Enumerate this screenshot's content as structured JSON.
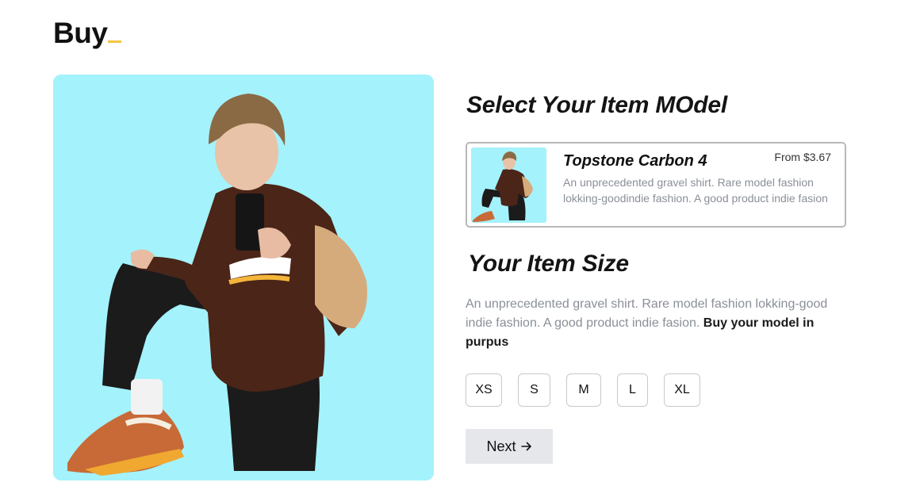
{
  "header": {
    "logo_text": "Buy",
    "logo_cursor_color": "#f4c542"
  },
  "hero": {
    "background_color": "#a4f2fb",
    "illustration": "person-in-brown-sweatshirt-kneeling"
  },
  "model_section": {
    "title": "Select Your Item MOdel",
    "card": {
      "name": "Topstone Carbon 4",
      "price": "From $3.67",
      "description": "An unprecedented gravel shirt. Rare model fashion lokking-goodindie fashion. A good product indie fasion"
    }
  },
  "size_section": {
    "title": "Your Item Size",
    "description": "An unprecedented gravel shirt. Rare model fashion lokking-good indie fashion. A good product indie fasion. ",
    "description_bold": "Buy your model in purpus",
    "sizes": [
      "XS",
      "S",
      "M",
      "L",
      "XL"
    ]
  },
  "actions": {
    "next_label": "Next",
    "next_icon": "arrow-right-icon"
  }
}
